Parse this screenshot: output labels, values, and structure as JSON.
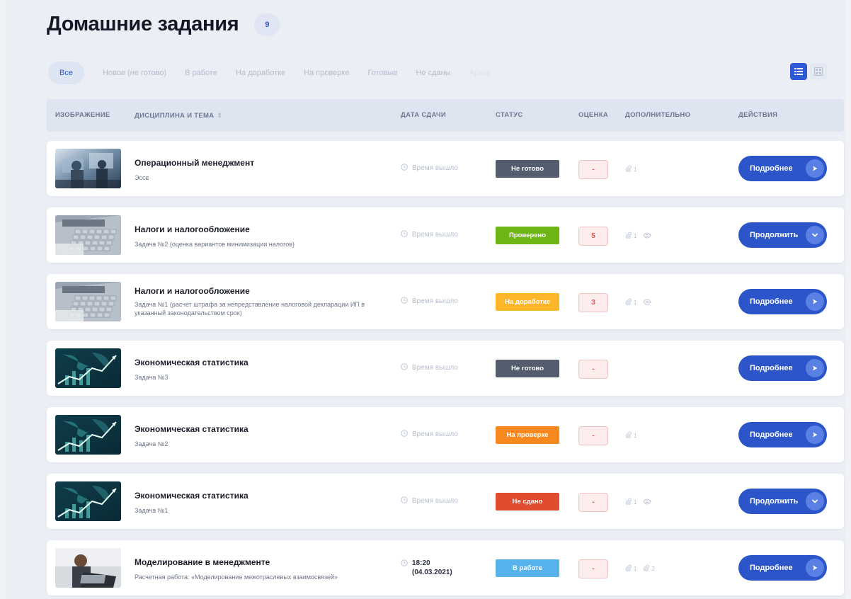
{
  "header": {
    "title": "Домашние задания",
    "count": "9"
  },
  "filters": [
    {
      "label": "Все",
      "active": true
    },
    {
      "label": "Новое (не готово)"
    },
    {
      "label": "В работе"
    },
    {
      "label": "На доработке"
    },
    {
      "label": "На проверке"
    },
    {
      "label": "Готовые"
    },
    {
      "label": "Не сданы"
    },
    {
      "label": "Архив",
      "faint": true
    }
  ],
  "columns": {
    "image": "ИЗОБРАЖЕНИЕ",
    "discipline": "ДИСЦИПЛИНА И ТЕМА",
    "due": "ДАТА СДАЧИ",
    "status": "СТАТУС",
    "grade": "ОЦЕНКА",
    "extra": "ДОПОЛНИТЕЛЬНО",
    "actions": "ДЕЙСТВИЯ"
  },
  "colors": {
    "accent": "#2b55c9",
    "status_not_ready": "#535d6e",
    "status_checked": "#6db514",
    "status_rework": "#fdb62a",
    "status_review": "#f7891f",
    "status_not_submitted": "#df4c2e",
    "status_in_work": "#58b2ec"
  },
  "rows": [
    {
      "title": "Операционный менеджмент",
      "subtitle": "Эссе",
      "thumb": "office",
      "due": "Время вышло",
      "status": "Не готово",
      "status_color": "#535d6e",
      "grade": "-",
      "attachments": "1",
      "views": "",
      "extra2": "",
      "action": "Подробнее",
      "action_icon": "arrow-right"
    },
    {
      "title": "Налоги и налогообложение",
      "subtitle": "Задача №2 (оценка вариантов минимизации налогов)",
      "thumb": "calculator",
      "due": "Время вышло",
      "status": "Проверено",
      "status_color": "#6db514",
      "grade": "5",
      "attachments": "1",
      "views": "eye",
      "extra2": "",
      "action": "Продолжить",
      "action_icon": "chevron-down"
    },
    {
      "title": "Налоги и налогообложение",
      "subtitle": "Задача №1 (расчет штрафа за непредставление налоговой декларации ИП в указанный законодательством срок)",
      "thumb": "calculator",
      "due": "Время вышло",
      "status": "На доработке",
      "status_color": "#fdb62a",
      "grade": "3",
      "attachments": "1",
      "views": "eye",
      "extra2": "",
      "action": "Подробнее",
      "action_icon": "arrow-right"
    },
    {
      "title": "Экономическая статистика",
      "subtitle": "Задача №3",
      "thumb": "stats",
      "due": "Время вышло",
      "status": "Не готово",
      "status_color": "#535d6e",
      "grade": "-",
      "attachments": "",
      "views": "",
      "extra2": "",
      "action": "Подробнее",
      "action_icon": "arrow-right"
    },
    {
      "title": "Экономическая статистика",
      "subtitle": "Задача №2",
      "thumb": "stats",
      "due": "Время вышло",
      "status": "На проверке",
      "status_color": "#f7891f",
      "grade": "-",
      "attachments": "1",
      "views": "",
      "extra2": "",
      "action": "Подробнее",
      "action_icon": "arrow-right"
    },
    {
      "title": "Экономическая статистика",
      "subtitle": "Задача №1",
      "thumb": "stats",
      "due": "Время вышло",
      "status": "Не сдано",
      "status_color": "#df4c2e",
      "grade": "-",
      "attachments": "1",
      "views": "eye",
      "extra2": "",
      "action": "Продолжить",
      "action_icon": "chevron-down"
    },
    {
      "title": "Моделирование в менеджменте",
      "subtitle": "Расчетная работа: «Моделирование межотраслевых взаимосвязей»",
      "thumb": "laptop",
      "due": "18:20",
      "due_date": "(04.03.2021)",
      "status": "В работе",
      "status_color": "#58b2ec",
      "grade": "-",
      "attachments": "1",
      "views": "",
      "extra2": "2",
      "action": "Подробнее",
      "action_icon": "arrow-right"
    }
  ]
}
